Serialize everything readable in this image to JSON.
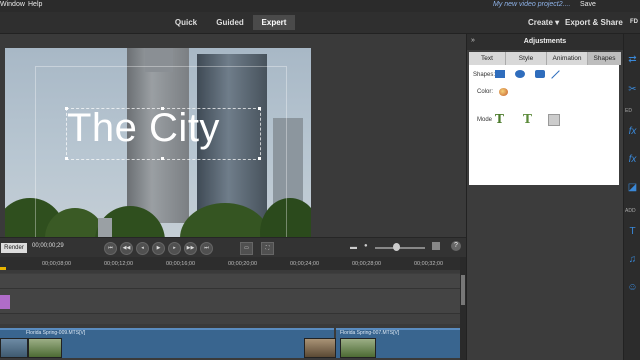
{
  "menubar": {
    "items": [
      "Window",
      "Help"
    ],
    "project_title": "My new video project2....",
    "save_label": "Save"
  },
  "modebar": {
    "tabs": [
      {
        "label": "Quick",
        "active": false
      },
      {
        "label": "Guided",
        "active": false
      },
      {
        "label": "Expert",
        "active": true
      }
    ],
    "create_label": "Create ▾",
    "export_label": "Export & Share",
    "edge_label": "FD"
  },
  "monitor": {
    "title_text": "The City"
  },
  "playbar": {
    "render_label": "Render",
    "timecode": "00;00;00;29",
    "controls": [
      "go-to-start",
      "step-back",
      "previous-frame",
      "play",
      "next-frame",
      "step-forward",
      "go-to-end"
    ]
  },
  "timeline": {
    "ticks": [
      "00;00;08;00",
      "00;00;12;00",
      "00;00;16;00",
      "00;00;20;00",
      "00;00;24;00",
      "00;00;28;00",
      "00;00;32;00"
    ],
    "clips": [
      {
        "label": "Florida Spring-009.MTS[V]"
      },
      {
        "label": "Florida Spring-007.MTS[V]"
      }
    ]
  },
  "adjustments": {
    "title": "Adjustments",
    "tabs": [
      {
        "label": "Text",
        "active": false
      },
      {
        "label": "Style",
        "active": false
      },
      {
        "label": "Animation",
        "active": false
      },
      {
        "label": "Shapes",
        "active": true
      }
    ],
    "shapes_label": "Shapes:",
    "color_label": "Color:",
    "mode_label": "Mode"
  },
  "right_strip": {
    "labels": [
      "ED",
      "ADD"
    ]
  },
  "colors": {
    "accent_blue": "#3a88d8",
    "clip_blue": "#39658f",
    "purple_clip": "#b06cc9",
    "project_title": "#8fb3e8"
  }
}
